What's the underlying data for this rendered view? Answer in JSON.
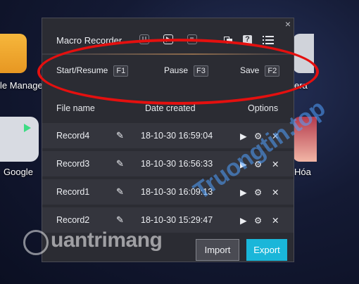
{
  "desktop": {
    "file_manager_label": "le Manager",
    "camera_label": "era",
    "google_label": "Google",
    "hoa_label": "Hóa"
  },
  "dialog": {
    "title": "Macro Recorder",
    "close": "×",
    "hotkeys": [
      {
        "label": "Start/Resume",
        "key": "F1"
      },
      {
        "label": "Pause",
        "key": "F3"
      },
      {
        "label": "Save",
        "key": "F2"
      }
    ],
    "columns": {
      "file_name": "File name",
      "date_created": "Date created",
      "options": "Options"
    },
    "records": [
      {
        "name": "Record4",
        "date": "18-10-30 16:59:04"
      },
      {
        "name": "Record3",
        "date": "18-10-30 16:56:33"
      },
      {
        "name": "Record1",
        "date": "18-10-30 16:09:13"
      },
      {
        "name": "Record2",
        "date": "18-10-30 15:29:47"
      }
    ],
    "import_label": "Import",
    "export_label": "Export"
  },
  "watermark": {
    "text": "uantrimang",
    "diag": "Truongtin.top"
  },
  "colors": {
    "accent": "#1ab6d9",
    "highlight": "#e4100f",
    "panel": "#2b2c33"
  },
  "icons": [
    "pause-icon",
    "play-icon",
    "stop-icon",
    "window-icon",
    "help-icon",
    "list-icon",
    "edit-icon",
    "play-icon",
    "gear-icon",
    "close-icon"
  ]
}
